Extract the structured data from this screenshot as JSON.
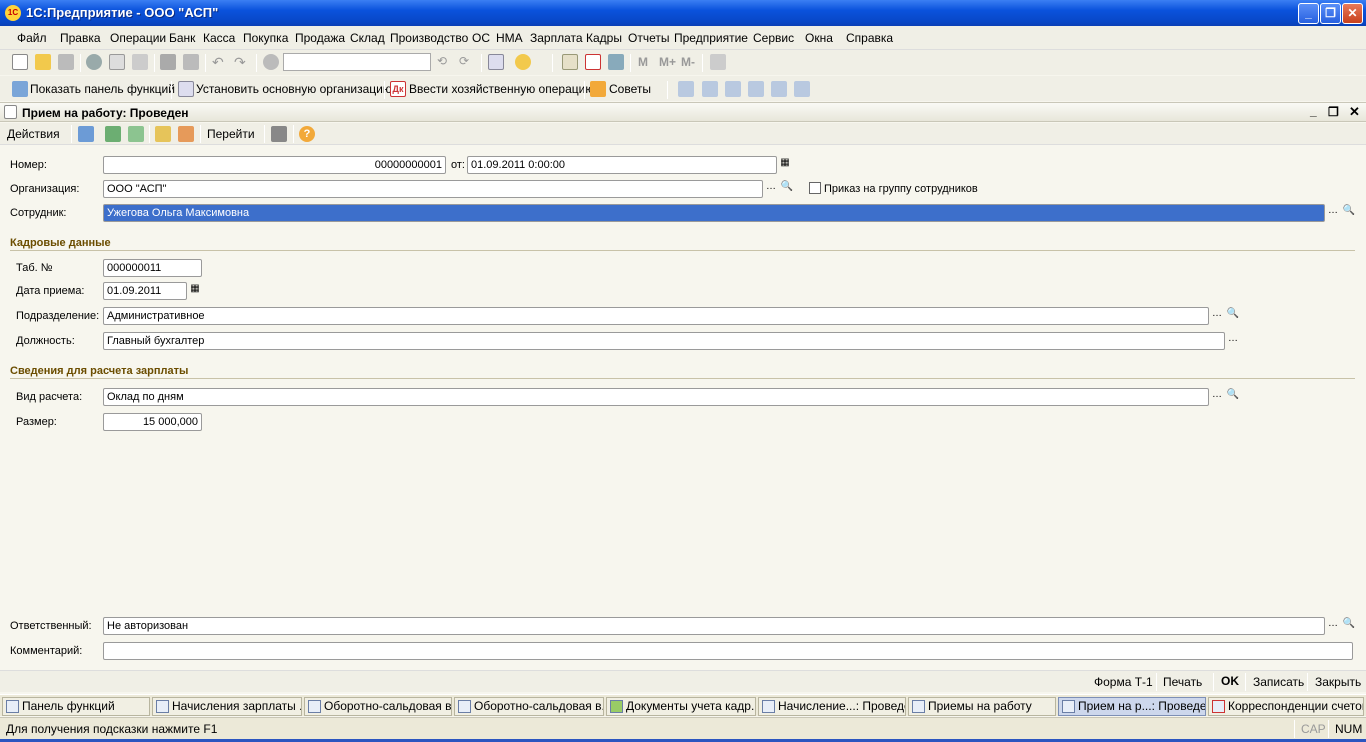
{
  "window": {
    "title": "1С:Предприятие - ООО \"АСП\"",
    "logo": "1С"
  },
  "menu": [
    "Файл",
    "Правка",
    "Операции",
    "Банк",
    "Касса",
    "Покупка",
    "Продажа",
    "Склад",
    "Производство",
    "ОС",
    "НМА",
    "Зарплата",
    "Кадры",
    "Отчеты",
    "Предприятие",
    "Сервис",
    "Окна",
    "Справка"
  ],
  "toolbar2": {
    "show_panel": "Показать панель функций",
    "set_org": "Установить основную организацию",
    "enter_op": "Ввести хозяйственную операцию",
    "tips": "Советы",
    "m1": "M",
    "m2": "M+",
    "m3": "M-"
  },
  "doc": {
    "title": "Прием на работу: Проведен",
    "actions": "Действия",
    "goto": "Перейти"
  },
  "form": {
    "number_label": "Номер:",
    "number": "00000000001",
    "from_label": "от:",
    "date": "01.09.2011  0:00:00",
    "org_label": "Организация:",
    "org": "ООО \"АСП\"",
    "group_order": "Приказ на группу сотрудников",
    "employee_label": "Сотрудник:",
    "employee": "Ужегова Ольга Максимовна",
    "hr_section": "Кадровые данные",
    "tab_label": "Таб. №",
    "tab": "000000011",
    "hire_date_label": "Дата приема:",
    "hire_date": "01.09.2011",
    "dept_label": "Подразделение:",
    "dept": "Административное",
    "position_label": "Должность:",
    "position": "Главный бухгалтер",
    "salary_section": "Сведения для расчета зарплаты",
    "calc_type_label": "Вид расчета:",
    "calc_type": "Оклад по дням",
    "amount_label": "Размер:",
    "amount": "15 000,000",
    "responsible_label": "Ответственный:",
    "responsible": "Не авторизован",
    "comment_label": "Комментарий:",
    "comment": ""
  },
  "bottom": {
    "form_t1": "Форма Т-1",
    "print": "Печать",
    "ok": "OK",
    "save": "Записать",
    "close": "Закрыть"
  },
  "tasks": [
    "Панель функций",
    "Начисления зарплаты ...",
    "Оборотно-сальдовая в...",
    "Оборотно-сальдовая в...",
    "Документы учета кадр...",
    "Начисление...: Проведен",
    "Приемы на работу",
    "Прием на р...: Проведен",
    "Корреспонденции счетов"
  ],
  "status": {
    "hint": "Для получения подсказки нажмите F1",
    "cap": "CAP",
    "num": "NUM"
  }
}
